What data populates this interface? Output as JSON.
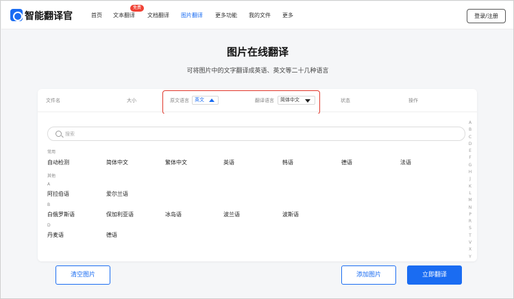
{
  "app": {
    "logo_text": "智能翻译官"
  },
  "nav": {
    "home": "首页",
    "text_translate": "文本翻译",
    "free_badge": "免费",
    "doc_translate": "文档翻译",
    "image_translate": "图片翻译",
    "more_features": "更多功能",
    "my_files": "我的文件",
    "more": "更多",
    "login": "登录/注册"
  },
  "hero": {
    "title": "图片在线翻译",
    "subtitle": "可将图片中的文字翻译成英语、英文等二十几种语言"
  },
  "table": {
    "headers": {
      "filename": "文件名",
      "size": "大小",
      "source_lang": "原文语言",
      "target_lang": "翻译语言",
      "status": "状态",
      "action": "操作"
    },
    "source_value": "英文",
    "target_value": "简体中文"
  },
  "dropdown": {
    "search_placeholder": "搜索",
    "common_label": "常用",
    "common": [
      "自动检测",
      "简体中文",
      "繁体中文",
      "英语",
      "韩语",
      "德语",
      "法语"
    ],
    "other_label": "其他",
    "groups": [
      {
        "letter": "A",
        "items": [
          "阿拉伯语",
          "爱尔兰语"
        ]
      },
      {
        "letter": "B",
        "items": [
          "白俄罗斯语",
          "保加利亚语",
          "冰岛语",
          "波兰语",
          "波斯语"
        ]
      },
      {
        "letter": "D",
        "items": [
          "丹麦语",
          "德语"
        ]
      }
    ],
    "alphabet": [
      "A",
      "B",
      "C",
      "D",
      "E",
      "F",
      "G",
      "H",
      "J",
      "K",
      "L",
      "M",
      "N",
      "P",
      "R",
      "S",
      "T",
      "V",
      "X",
      "Y"
    ]
  },
  "buttons": {
    "clear": "清空图片",
    "add": "添加图片",
    "translate": "立即翻译"
  },
  "colors": {
    "accent": "#1a6cf2",
    "highlight_border": "#e0362a",
    "badge": "#f04134"
  }
}
